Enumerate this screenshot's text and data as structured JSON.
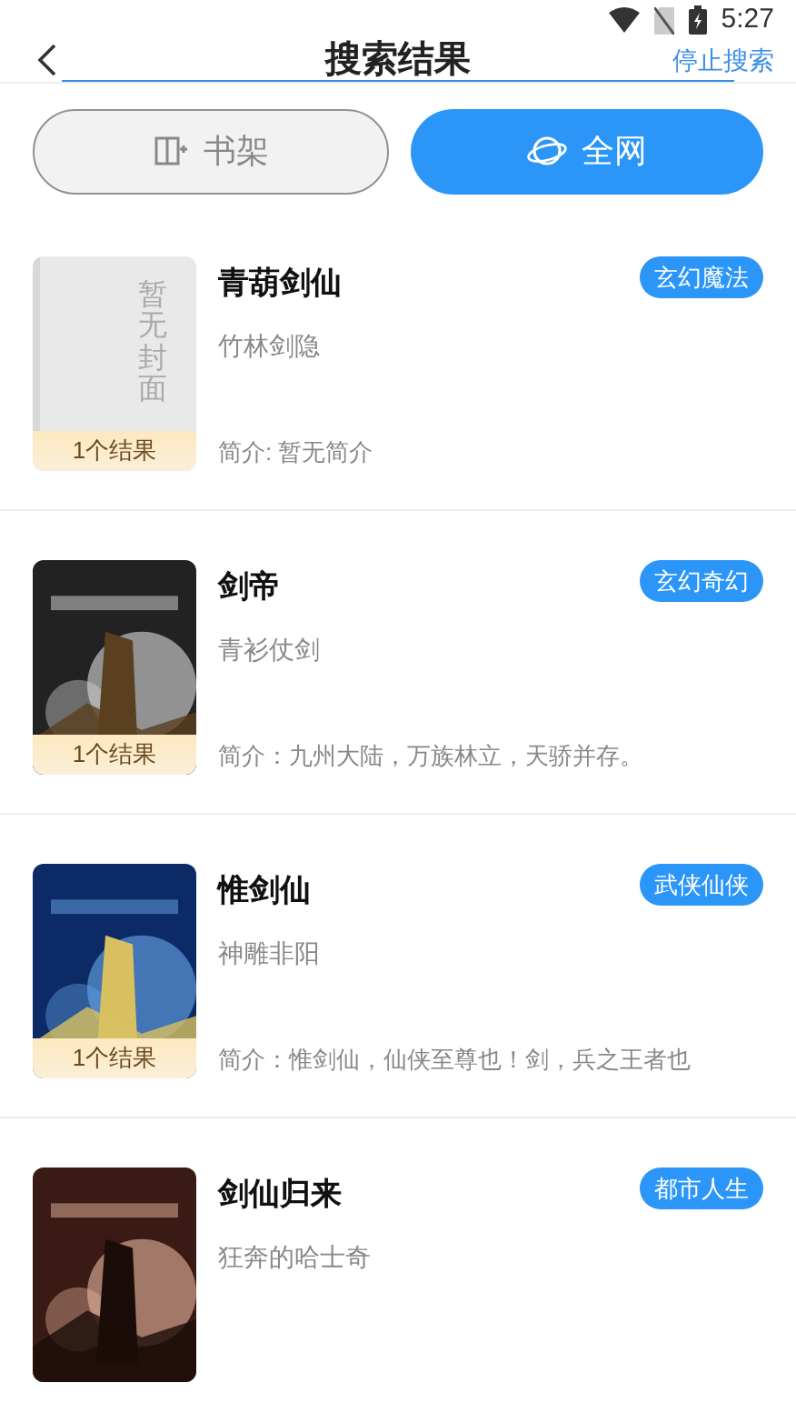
{
  "status_bar": {
    "time": "5:27"
  },
  "header": {
    "title": "搜索结果",
    "action": "停止搜索"
  },
  "tabs": [
    {
      "label": "书架",
      "kind": "shelf",
      "selected": false
    },
    {
      "label": "全网",
      "kind": "web",
      "selected": true
    }
  ],
  "results": [
    {
      "title": "青葫剑仙",
      "author": "竹林剑隐",
      "intro": "简介: 暂无简介",
      "tag": "玄幻魔法",
      "count": "1个结果",
      "cover": {
        "kind": "placeholder",
        "text": "暂无封面"
      }
    },
    {
      "title": "剑帝",
      "author": "青衫仗剑",
      "intro": "简介：九州大陆，万族林立，天骄并存。",
      "tag": "玄幻奇幻",
      "count": "1个结果"
    },
    {
      "title": "惟剑仙",
      "author": "神雕非阳",
      "intro": "简介：惟剑仙，仙侠至尊也！剑，兵之王者也",
      "tag": "武侠仙侠",
      "count": "1个结果"
    },
    {
      "title": "剑仙归来",
      "author": "狂奔的哈士奇",
      "tag": "都市人生"
    }
  ]
}
